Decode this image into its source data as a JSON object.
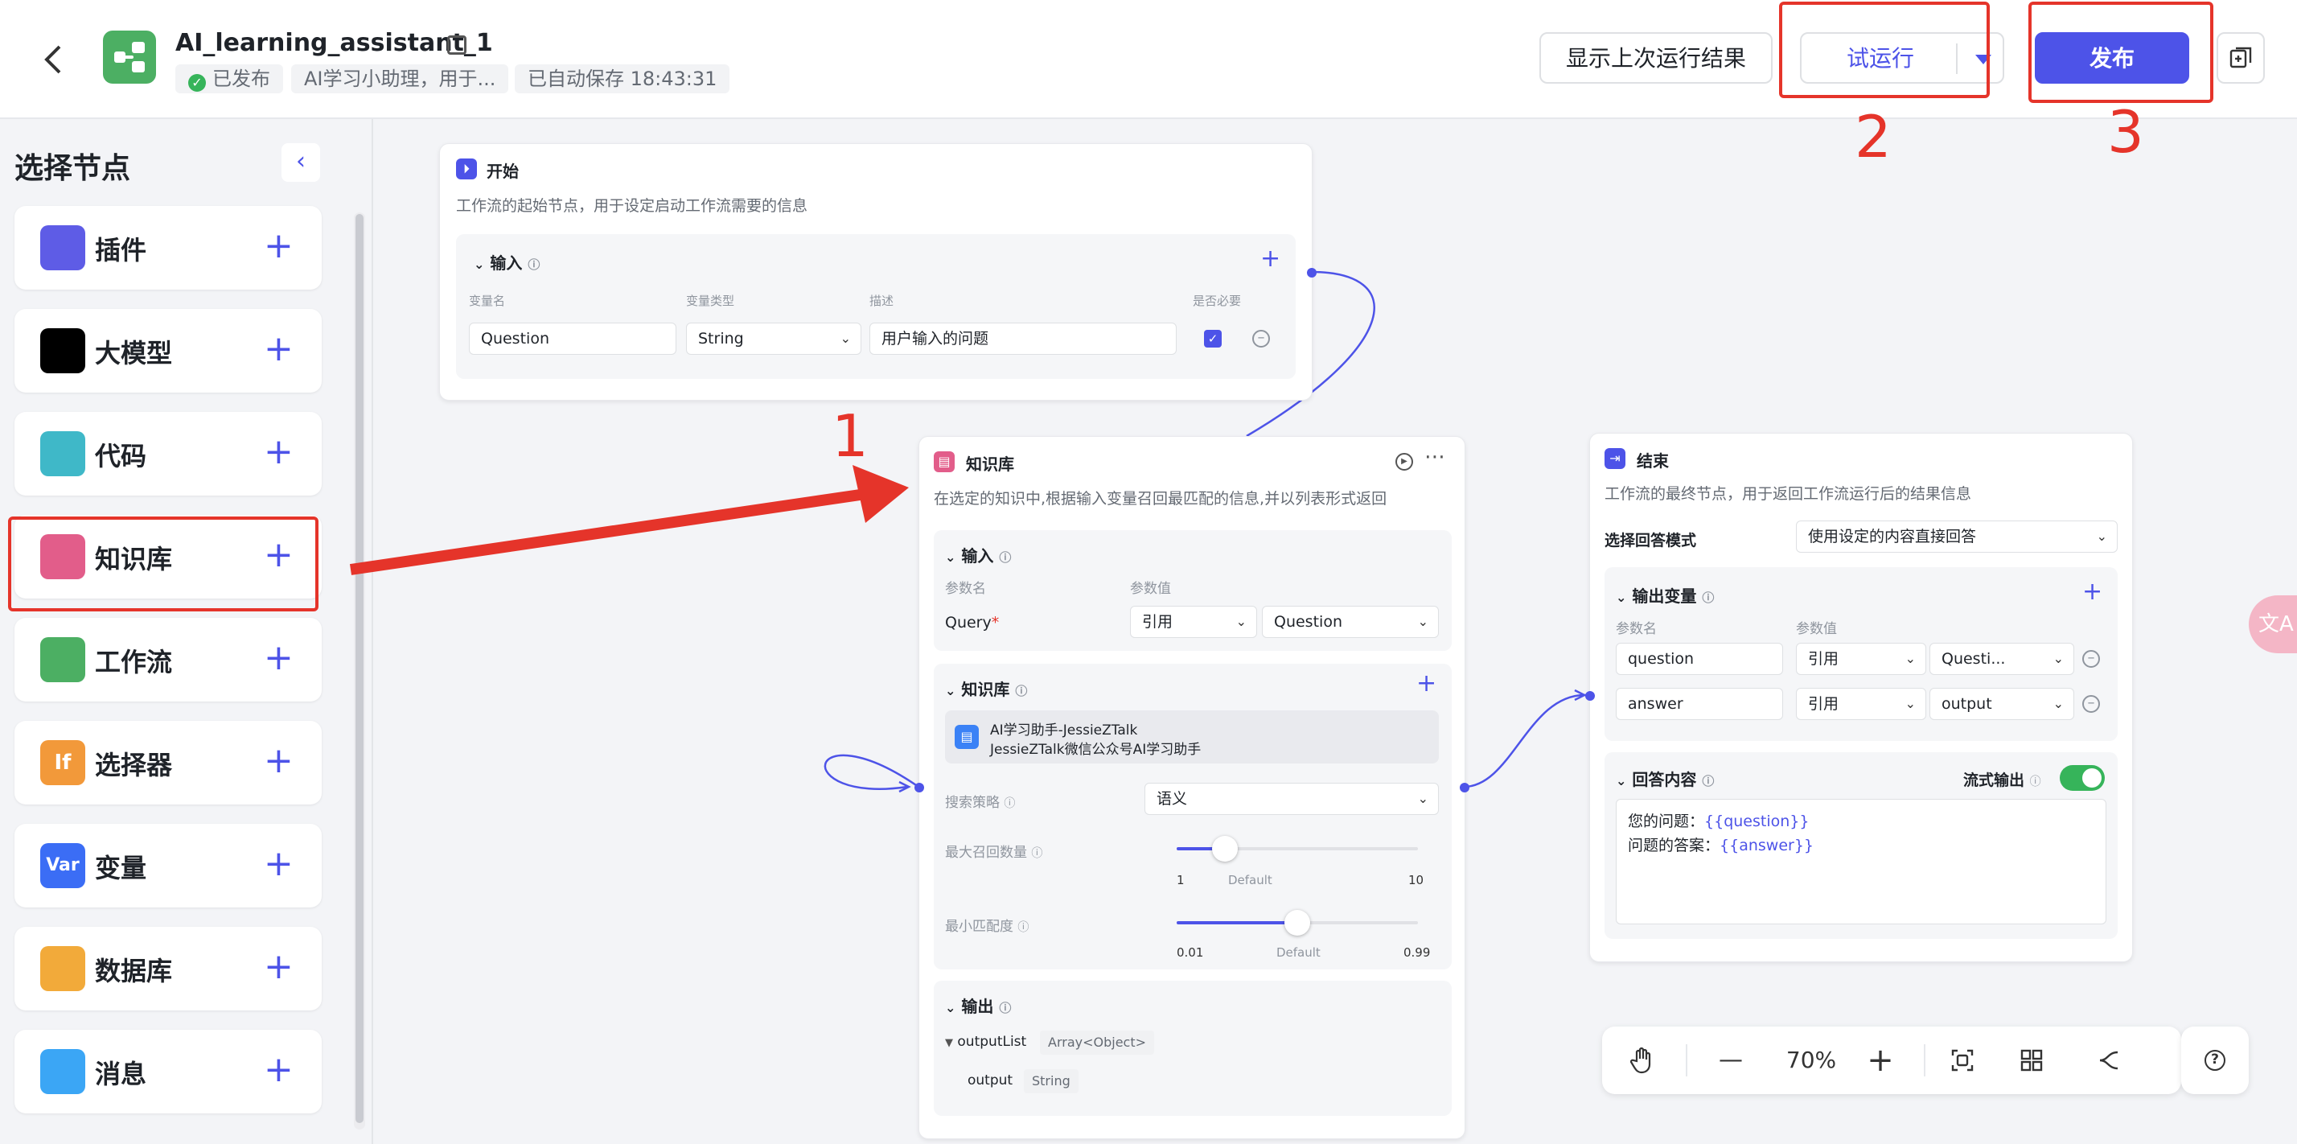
{
  "header": {
    "title": "AI_learning_assistant_1",
    "status": "已发布",
    "description": "AI学习小助理，用于...",
    "autosave": "已自动保存 18:43:31",
    "show_last_result": "显示上次运行结果",
    "test_run": "试运行",
    "publish": "发布"
  },
  "annotations": {
    "n1": "1",
    "n2": "2",
    "n3": "3"
  },
  "sidebar": {
    "title": "选择节点",
    "items": [
      {
        "label": "插件",
        "icon": "cube-icon",
        "color": "#5e5ce6"
      },
      {
        "label": "大模型",
        "icon": "llm-face-icon",
        "color": "#000000"
      },
      {
        "label": "代码",
        "icon": "code-icon",
        "color": "#3fb8c8"
      },
      {
        "label": "知识库",
        "icon": "knowledge-icon",
        "color": "#e25d8a"
      },
      {
        "label": "工作流",
        "icon": "workflow-icon",
        "color": "#4caf63"
      },
      {
        "label": "选择器",
        "icon": "if-icon",
        "color": "#f2993a",
        "glyph": "If"
      },
      {
        "label": "变量",
        "icon": "var-icon",
        "color": "#3b6df5",
        "glyph": "Var"
      },
      {
        "label": "数据库",
        "icon": "database-icon",
        "color": "#f2aa3a"
      },
      {
        "label": "消息",
        "icon": "message-icon",
        "color": "#3ba6f5"
      }
    ]
  },
  "start_node": {
    "title": "开始",
    "desc": "工作流的起始节点，用于设定启动工作流需要的信息",
    "input_title": "输入",
    "col_name": "变量名",
    "col_type": "变量类型",
    "col_desc": "描述",
    "col_required": "是否必要",
    "var_name": "Question",
    "var_type": "String",
    "var_desc": "用户输入的问题"
  },
  "kb_node": {
    "title": "知识库",
    "desc": "在选定的知识中,根据输入变量召回最匹配的信息,并以列表形式返回",
    "input_title": "输入",
    "col_param": "参数名",
    "col_value": "参数值",
    "query_label": "Query",
    "ref": "引用",
    "query_value": "Question",
    "kb_title": "知识库",
    "kb_item_name": "AI学习助手-JessieZTalk",
    "kb_item_desc": "JessieZTalk微信公众号AI学习助手",
    "strategy_label": "搜索策略",
    "strategy_value": "语义",
    "max_label": "最大召回数量",
    "max_min": "1",
    "max_default": "Default",
    "max_max": "10",
    "max_level": 0.2,
    "min_label": "最小匹配度",
    "min_min": "0.01",
    "min_default": "Default",
    "min_max": "0.99",
    "min_level": 0.5,
    "output_title": "输出",
    "out_list": "outputList",
    "out_list_type": "Array<Object>",
    "out_item": "output",
    "out_item_type": "String"
  },
  "end_node": {
    "title": "结束",
    "desc": "工作流的最终节点，用于返回工作流运行后的结果信息",
    "mode_label": "选择回答模式",
    "mode_value": "使用设定的内容直接回答",
    "out_title": "输出变量",
    "col_param": "参数名",
    "col_value": "参数值",
    "rows": [
      {
        "name": "question",
        "ref": "引用",
        "value": "Questi..."
      },
      {
        "name": "answer",
        "ref": "引用",
        "value": "output"
      }
    ],
    "answer_title": "回答内容",
    "stream_label": "流式输出",
    "line1_prefix": "您的问题：",
    "line1_var": "{{question}}",
    "line2_prefix": "问题的答案：",
    "line2_var": "{{answer}}"
  },
  "toolbar": {
    "zoom": "70%"
  },
  "colors": {
    "accent": "#4d53e8",
    "annotation": "#e5342a"
  }
}
